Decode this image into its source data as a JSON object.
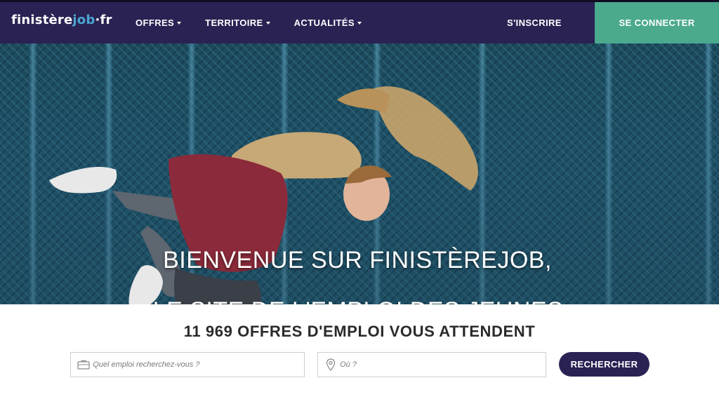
{
  "brand": {
    "logo_part1": "finistère",
    "logo_part2": "job",
    "logo_part3": "·fr",
    "color_primary": "#2a2253",
    "color_accent": "#4ba98e"
  },
  "nav": {
    "items": [
      {
        "label": "OFFRES"
      },
      {
        "label": "TERRITOIRE"
      },
      {
        "label": "ACTUALITÉS"
      }
    ],
    "signup_label": "S'INSCRIRE",
    "login_label": "SE CONNECTER"
  },
  "hero": {
    "line1": "BIENVENUE SUR FINISTÈREJOB,",
    "line2": "LE SITE DE L'EMPLOI DES JEUNES"
  },
  "search": {
    "headline": "11 969 OFFRES D'EMPLOI VOUS ATTENDENT",
    "what_placeholder": "Quel emploi recherchez-vous ?",
    "where_placeholder": "Où ?",
    "submit_label": "RECHERCHER",
    "what_icon": "briefcase-icon",
    "where_icon": "map-pin-icon"
  }
}
